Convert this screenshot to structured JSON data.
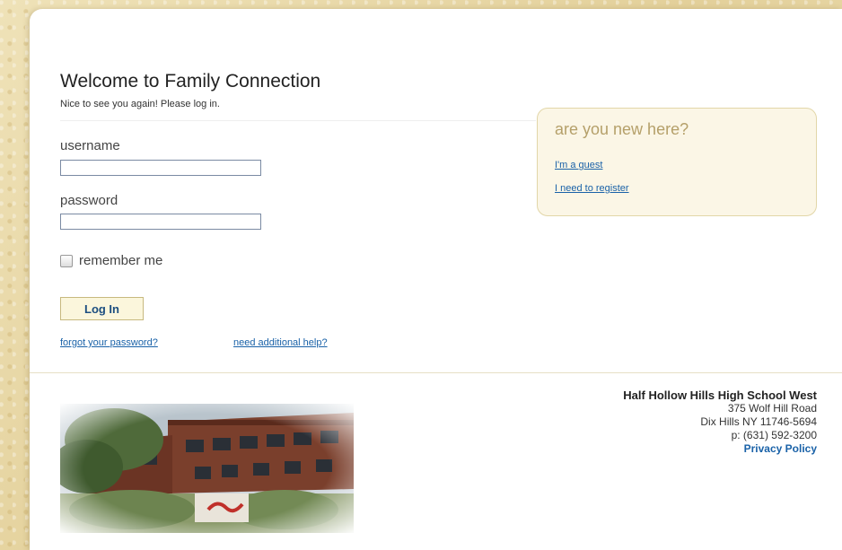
{
  "login": {
    "title": "Welcome to Family Connection",
    "subtitle": "Nice to see you again! Please log in.",
    "username_label": "username",
    "username_value": "",
    "password_label": "password",
    "password_value": "",
    "remember_label": "remember me",
    "login_button": "Log In",
    "forgot_link": "forgot your password?",
    "help_link": "need additional help?"
  },
  "new_here": {
    "title": "are you new here?",
    "guest_link": "I'm a guest",
    "register_link": "I need to register"
  },
  "school": {
    "name": "Half Hollow Hills High School West",
    "address1": "375 Wolf Hill Road",
    "address2": "Dix Hills NY 11746-5694",
    "phone": "p: (631) 592-3200",
    "privacy_link": "Privacy Policy"
  },
  "colors": {
    "link": "#1a62a8",
    "accent_title": "#b5a06a",
    "button_bg": "#fbf6dc"
  }
}
